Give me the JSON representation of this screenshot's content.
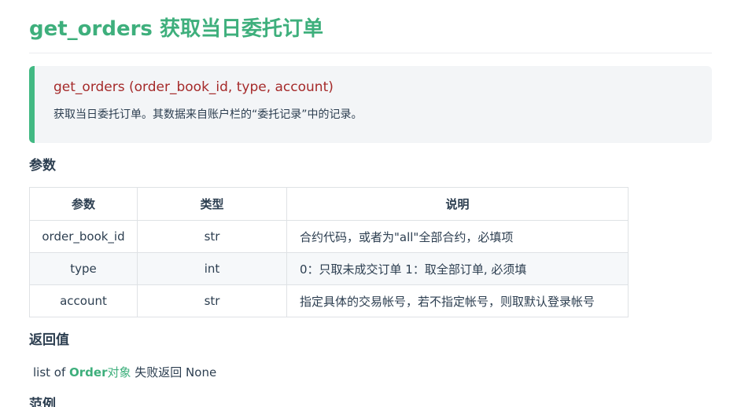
{
  "page": {
    "title": "get_orders 获取当日委托订单",
    "signature": "get_orders (order_book_id, type, account)",
    "description": "获取当日委托订单。其数据来自账户栏的“委托记录”中的记录。"
  },
  "params_section": {
    "heading": "参数",
    "columns": [
      "参数",
      "类型",
      "说明"
    ],
    "rows": [
      {
        "name": "order_book_id",
        "type": "str",
        "desc": "合约代码，或者为\"all\"全部合约，必填项"
      },
      {
        "name": "type",
        "type": "int",
        "desc": "0：只取未成交订单  1：取全部订单, 必须填"
      },
      {
        "name": "account",
        "type": "str",
        "desc": "指定具体的交易帐号，若不指定帐号，则取默认登录帐号"
      }
    ]
  },
  "returns_section": {
    "heading": "返回值",
    "prefix": "list of ",
    "link_bold": "Order",
    "link_tail": "对象",
    "suffix": " 失败返回 None"
  },
  "example_section": {
    "heading": "范例"
  },
  "colors": {
    "accent": "#3eaf7c",
    "signature": "#a52a2a",
    "callout_bg": "#f3f5f7",
    "callout_border": "#42b983"
  }
}
